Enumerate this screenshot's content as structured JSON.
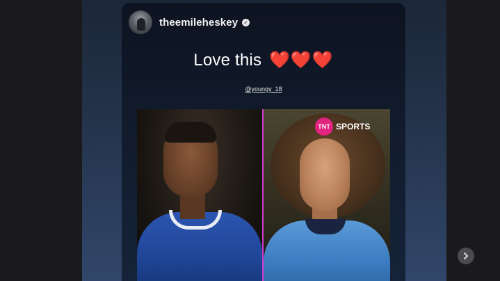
{
  "story": {
    "username": "theemileheskey",
    "caption_text": "Love this",
    "caption_hearts": "❤️❤️❤️",
    "mention": "@youngy_18",
    "image": {
      "overlay_brand_badge": "TNT",
      "overlay_brand_text": "SPORTS"
    }
  },
  "icons": {
    "verified": "verified-badge-icon",
    "next": "chevron-right-icon"
  },
  "colors": {
    "heart": "#e0212b",
    "divider": "#d23bd0",
    "brand": "#e2237f"
  }
}
